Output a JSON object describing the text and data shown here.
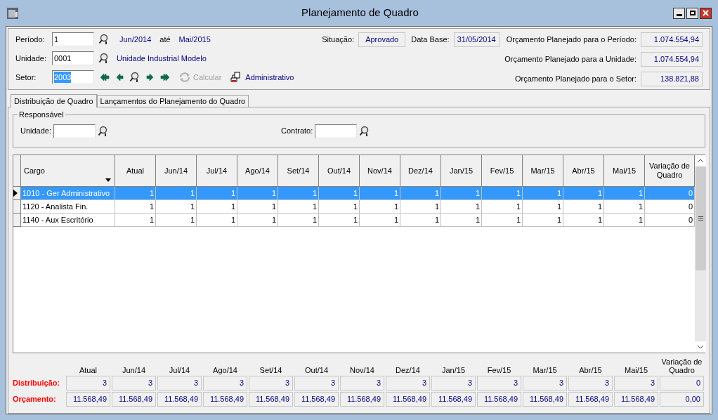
{
  "window": {
    "title": "Planejamento de Quadro"
  },
  "header": {
    "periodo": {
      "label": "Período:",
      "value": "1",
      "from": "Jun/2014",
      "between": "até",
      "to": "Mai/2015"
    },
    "unidade": {
      "label": "Unidade:",
      "value": "0001",
      "name": "Unidade Industrial Modelo"
    },
    "setor": {
      "label": "Setor:",
      "value": "2003",
      "highlighted": true,
      "calcular": {
        "label": "Calcular",
        "disabled": true
      },
      "name": "Administrativo"
    },
    "situacao": {
      "label": "Situação:",
      "value": "Aprovado"
    },
    "data_base": {
      "label": "Data Base:",
      "value": "31/05/2014"
    },
    "totals": [
      {
        "label": "Orçamento Planejado para o Período:",
        "value": "1.074.554,94"
      },
      {
        "label": "Orçamento Planejado para a Unidade:",
        "value": "1.074.554,94"
      },
      {
        "label": "Orçamento Planejado para o Setor:",
        "value": "138.821,88"
      }
    ]
  },
  "tabs": [
    {
      "label": "Distribuição de Quadro",
      "selected": true
    },
    {
      "label": "Lançamentos do Planejamento do Quadro",
      "selected": false
    }
  ],
  "responsavel": {
    "title": "Responsável",
    "fields": [
      {
        "label": "Unidade:"
      },
      {
        "label": "Contrato:"
      }
    ]
  },
  "grid": {
    "columns": [
      "Cargo",
      "Atual",
      "Jun/14",
      "Jul/14",
      "Ago/14",
      "Set/14",
      "Out/14",
      "Nov/14",
      "Dez/14",
      "Jan/15",
      "Fev/15",
      "Mar/15",
      "Abr/15",
      "Mai/15",
      "Variação de Quadro"
    ],
    "rows": [
      {
        "selected": true,
        "cells": [
          "1010 - Ger Administrativo",
          "1",
          "1",
          "1",
          "1",
          "1",
          "1",
          "1",
          "1",
          "1",
          "1",
          "1",
          "1",
          "1",
          "0"
        ]
      },
      {
        "selected": false,
        "cells": [
          "1120 - Analista Fin.",
          "1",
          "1",
          "1",
          "1",
          "1",
          "1",
          "1",
          "1",
          "1",
          "1",
          "1",
          "1",
          "1",
          "0"
        ]
      },
      {
        "selected": false,
        "cells": [
          "1140 - Aux Escritório",
          "1",
          "1",
          "1",
          "1",
          "1",
          "1",
          "1",
          "1",
          "1",
          "1",
          "1",
          "1",
          "1",
          "0"
        ]
      }
    ]
  },
  "summary": {
    "columns": [
      "Atual",
      "Jun/14",
      "Jul/14",
      "Ago/14",
      "Set/14",
      "Out/14",
      "Nov/14",
      "Dez/14",
      "Jan/15",
      "Fev/15",
      "Mar/15",
      "Abr/15",
      "Mai/15",
      "Variação de Quadro"
    ],
    "rows": [
      {
        "label": "Distribuição:",
        "values": [
          "3",
          "3",
          "3",
          "3",
          "3",
          "3",
          "3",
          "3",
          "3",
          "3",
          "3",
          "3",
          "3",
          "0"
        ]
      },
      {
        "label": "Orçamento:",
        "values": [
          "11.568,49",
          "11.568,49",
          "11.568,49",
          "11.568,49",
          "11.568,49",
          "11.568,49",
          "11.568,49",
          "11.568,49",
          "11.568,49",
          "11.568,49",
          "11.568,49",
          "11.568,49",
          "11.568,49",
          "0,00"
        ]
      }
    ]
  }
}
